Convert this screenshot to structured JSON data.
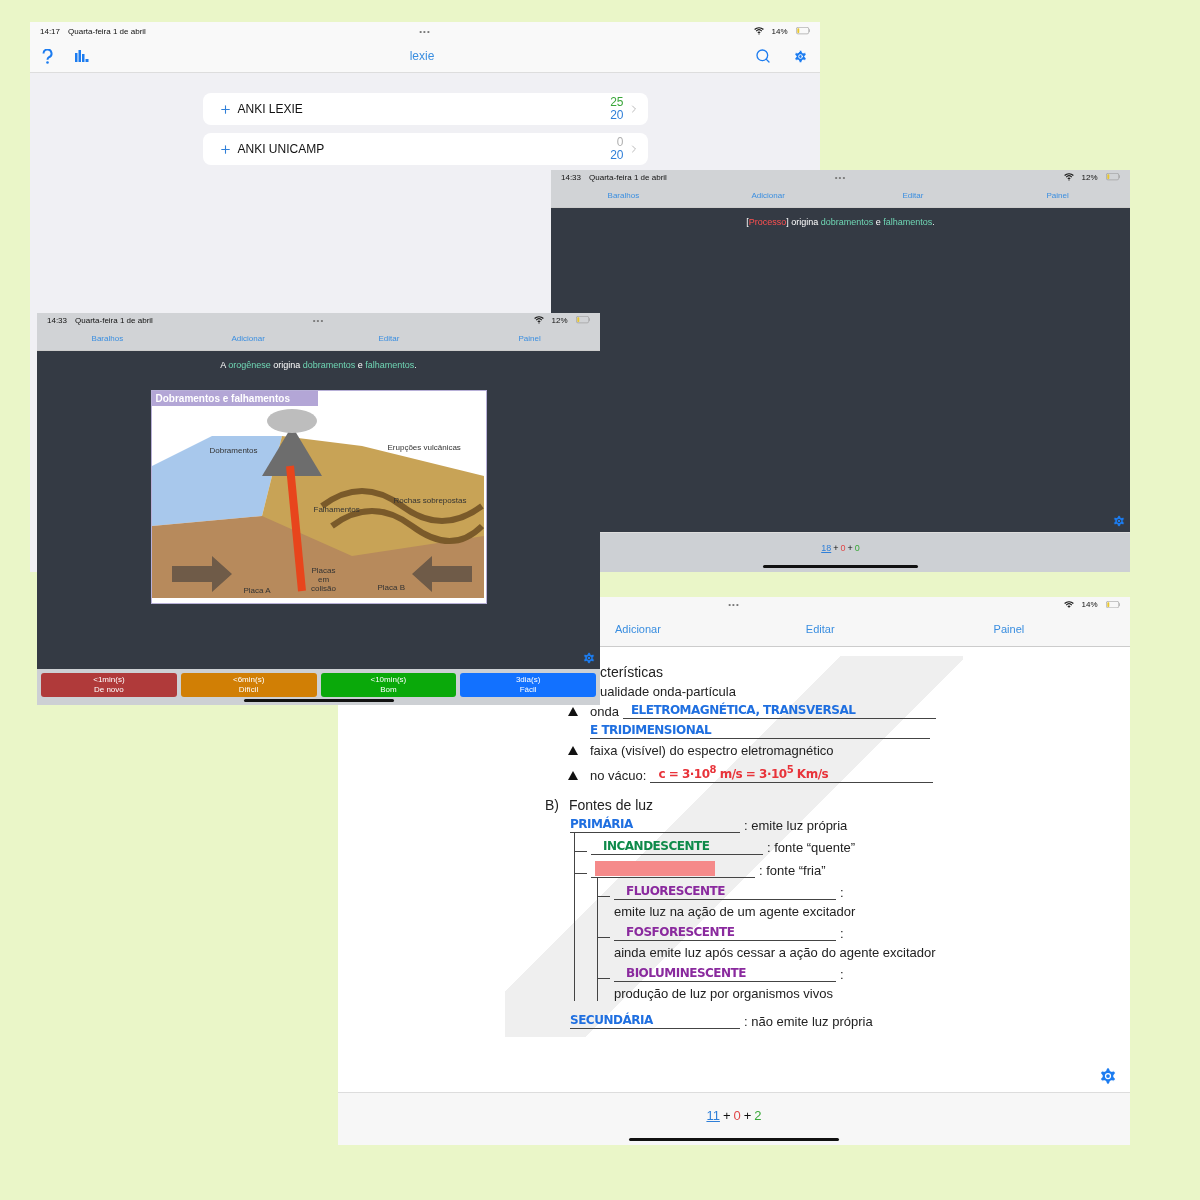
{
  "deck_screen": {
    "status_bar": {
      "time": "14:17",
      "date": "Quarta-feira 1 de abril",
      "dots": "•••",
      "battery": "14%"
    },
    "title": "lexie",
    "decks": [
      {
        "name": "ANKI LEXIE",
        "new_count": {
          "text": "25",
          "color": "#3aa63a"
        },
        "due_count": "20"
      },
      {
        "name": "ANKI UNICAMP",
        "new_count": {
          "text": "0",
          "color": "#b0b0b0"
        },
        "due_count": "20"
      }
    ]
  },
  "answer_screen": {
    "status_bar": {
      "time": "14:33",
      "date": "Quarta-feira 1 de abril",
      "dots": "•••",
      "battery": "12%"
    },
    "nav": [
      "Baralhos",
      "Adicionar",
      "Editar",
      "Painel"
    ],
    "sentence": [
      {
        "kind": "plain",
        "text": "["
      },
      {
        "kind": "mask",
        "text": "Processo"
      },
      {
        "kind": "plain",
        "text": "] origina "
      },
      {
        "kind": "highlight",
        "text": "dobramentos"
      },
      {
        "kind": "plain",
        "text": " e "
      },
      {
        "kind": "highlight",
        "text": "falhamentos"
      },
      {
        "kind": "plain",
        "text": "."
      }
    ],
    "counts": [
      {
        "kind": "new",
        "text": "18"
      },
      {
        "kind": "learn",
        "text": "0"
      },
      {
        "kind": "review",
        "text": "0"
      }
    ],
    "separator": "+"
  },
  "question_screen": {
    "status_bar": {
      "time": "14:33",
      "date": "Quarta-feira 1 de abril",
      "dots": "•••",
      "battery": "12%"
    },
    "nav": [
      "Baralhos",
      "Adicionar",
      "Editar",
      "Painel"
    ],
    "sentence": [
      {
        "kind": "plain",
        "text": "A "
      },
      {
        "kind": "highlight",
        "text": "orogênese"
      },
      {
        "kind": "plain",
        "text": " origina "
      },
      {
        "kind": "highlight",
        "text": "dobramentos"
      },
      {
        "kind": "plain",
        "text": " e "
      },
      {
        "kind": "highlight",
        "text": "falhamentos"
      },
      {
        "kind": "plain",
        "text": "."
      }
    ],
    "figure": {
      "title": "Dobramentos e falhamentos",
      "labels": [
        "Dobramentos",
        "Erupções vulcânicas",
        "Rochas sobrepostas",
        "Falhamentos",
        "Placas em colisão",
        "Placa A",
        "Placa B"
      ]
    },
    "answer_buttons": [
      {
        "kind": "again",
        "interval": "<1min(s)",
        "label": "De novo"
      },
      {
        "kind": "hard",
        "interval": "<6min(s)",
        "label": "Difícil"
      },
      {
        "kind": "good",
        "interval": "<10min(s)",
        "label": "Bom"
      },
      {
        "kind": "easy",
        "interval": "3dia(s)",
        "label": "Fácil"
      }
    ]
  },
  "notes_screen": {
    "status_bar": {
      "dots": "•••",
      "battery": "14%"
    },
    "nav": [
      "Adicionar",
      "Editar",
      "Painel"
    ],
    "document": {
      "heading": "cterísticas",
      "items": [
        {
          "kind": "text",
          "text": "ualidade onda-partícula"
        },
        {
          "kind": "bullet",
          "text": "onda",
          "answer": "ELETROMAGNÉTICA, TRANSVERSAL",
          "color": "#1f6fe0"
        },
        {
          "kind": "continuation",
          "answer": "E TRIDIMENSIONAL",
          "color": "#1f6fe0"
        },
        {
          "kind": "bullet",
          "text": "faixa (visível) do espectro eletromagnético"
        },
        {
          "kind": "bullet",
          "text": "no vácuo:",
          "answer": "c = 3·10$^{8}$ m/s = 3·10$^{5}$ Km/s",
          "color": "#e8333a"
        }
      ],
      "section_letter": "B)",
      "section_title": "Fontes de luz",
      "tree": [
        {
          "answer": "PRIMÁRIA",
          "color": "#1f6fe0",
          "masked": false,
          "desc": ": emite luz própria",
          "children": [
            {
              "answer": "INCANDESCENTE",
              "color": "#0e8a4a",
              "masked": false,
              "desc": ": fonte “quente”"
            },
            {
              "masked": true,
              "desc": ": fonte “fria”",
              "children": [
                {
                  "answer": "FLUORESCENTE",
                  "color": "#8a2a9e",
                  "masked": false,
                  "desc": ":",
                  "note": "emite luz na ação de um agente excitador"
                },
                {
                  "answer": "FOSFORESCENTE",
                  "color": "#8a2a9e",
                  "masked": false,
                  "desc": ":",
                  "note": "ainda emite luz após cessar a ação do agente excitador"
                },
                {
                  "answer": "BIOLUMINESCENTE",
                  "color": "#8a2a9e",
                  "masked": false,
                  "desc": ":",
                  "note": "produção de luz por organismos vivos"
                }
              ]
            }
          ]
        },
        {
          "answer": "SECUNDÁRIA",
          "color": "#1f6fe0",
          "masked": false,
          "desc": ": não emite luz própria"
        }
      ]
    },
    "counts": [
      {
        "kind": "new",
        "text": "11"
      },
      {
        "kind": "learn",
        "text": "0"
      },
      {
        "kind": "review",
        "text": "2"
      }
    ],
    "separator": "+"
  }
}
